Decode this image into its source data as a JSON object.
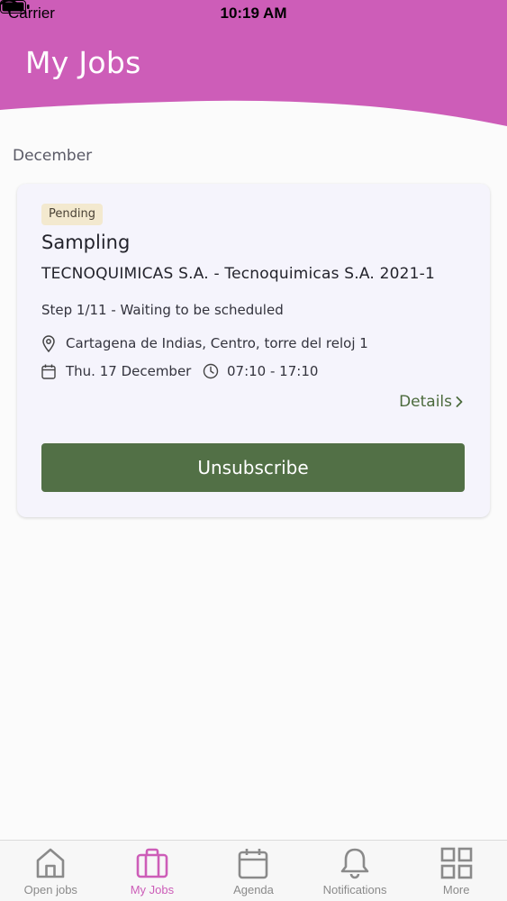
{
  "status_bar": {
    "carrier": "Carrier",
    "time": "10:19 AM"
  },
  "header": {
    "title": "My Jobs",
    "color": "#cd5db8"
  },
  "section": {
    "label": "December"
  },
  "job": {
    "status": "Pending",
    "title": "Sampling",
    "company": "TECNOQUIMICAS S.A. - Tecnoquimicas S.A. 2021-1",
    "step": "Step 1/11 - Waiting to be scheduled",
    "location": "Cartagena de Indias, Centro, torre del reloj 1",
    "date": "Thu. 17 December",
    "time_range": "07:10 - 17:10",
    "details_label": "Details",
    "unsubscribe_label": "Unsubscribe"
  },
  "tabs": [
    {
      "label": "Open jobs",
      "icon": "home-icon",
      "active": false
    },
    {
      "label": "My Jobs",
      "icon": "briefcase-icon",
      "active": true
    },
    {
      "label": "Agenda",
      "icon": "calendar-icon",
      "active": false
    },
    {
      "label": "Notifications",
      "icon": "bell-icon",
      "active": false
    },
    {
      "label": "More",
      "icon": "grid-icon",
      "active": false
    }
  ],
  "colors": {
    "accent": "#cd5db8",
    "button": "#527046",
    "link": "#4b6a3c",
    "badge_bg": "#f3e9cf"
  }
}
